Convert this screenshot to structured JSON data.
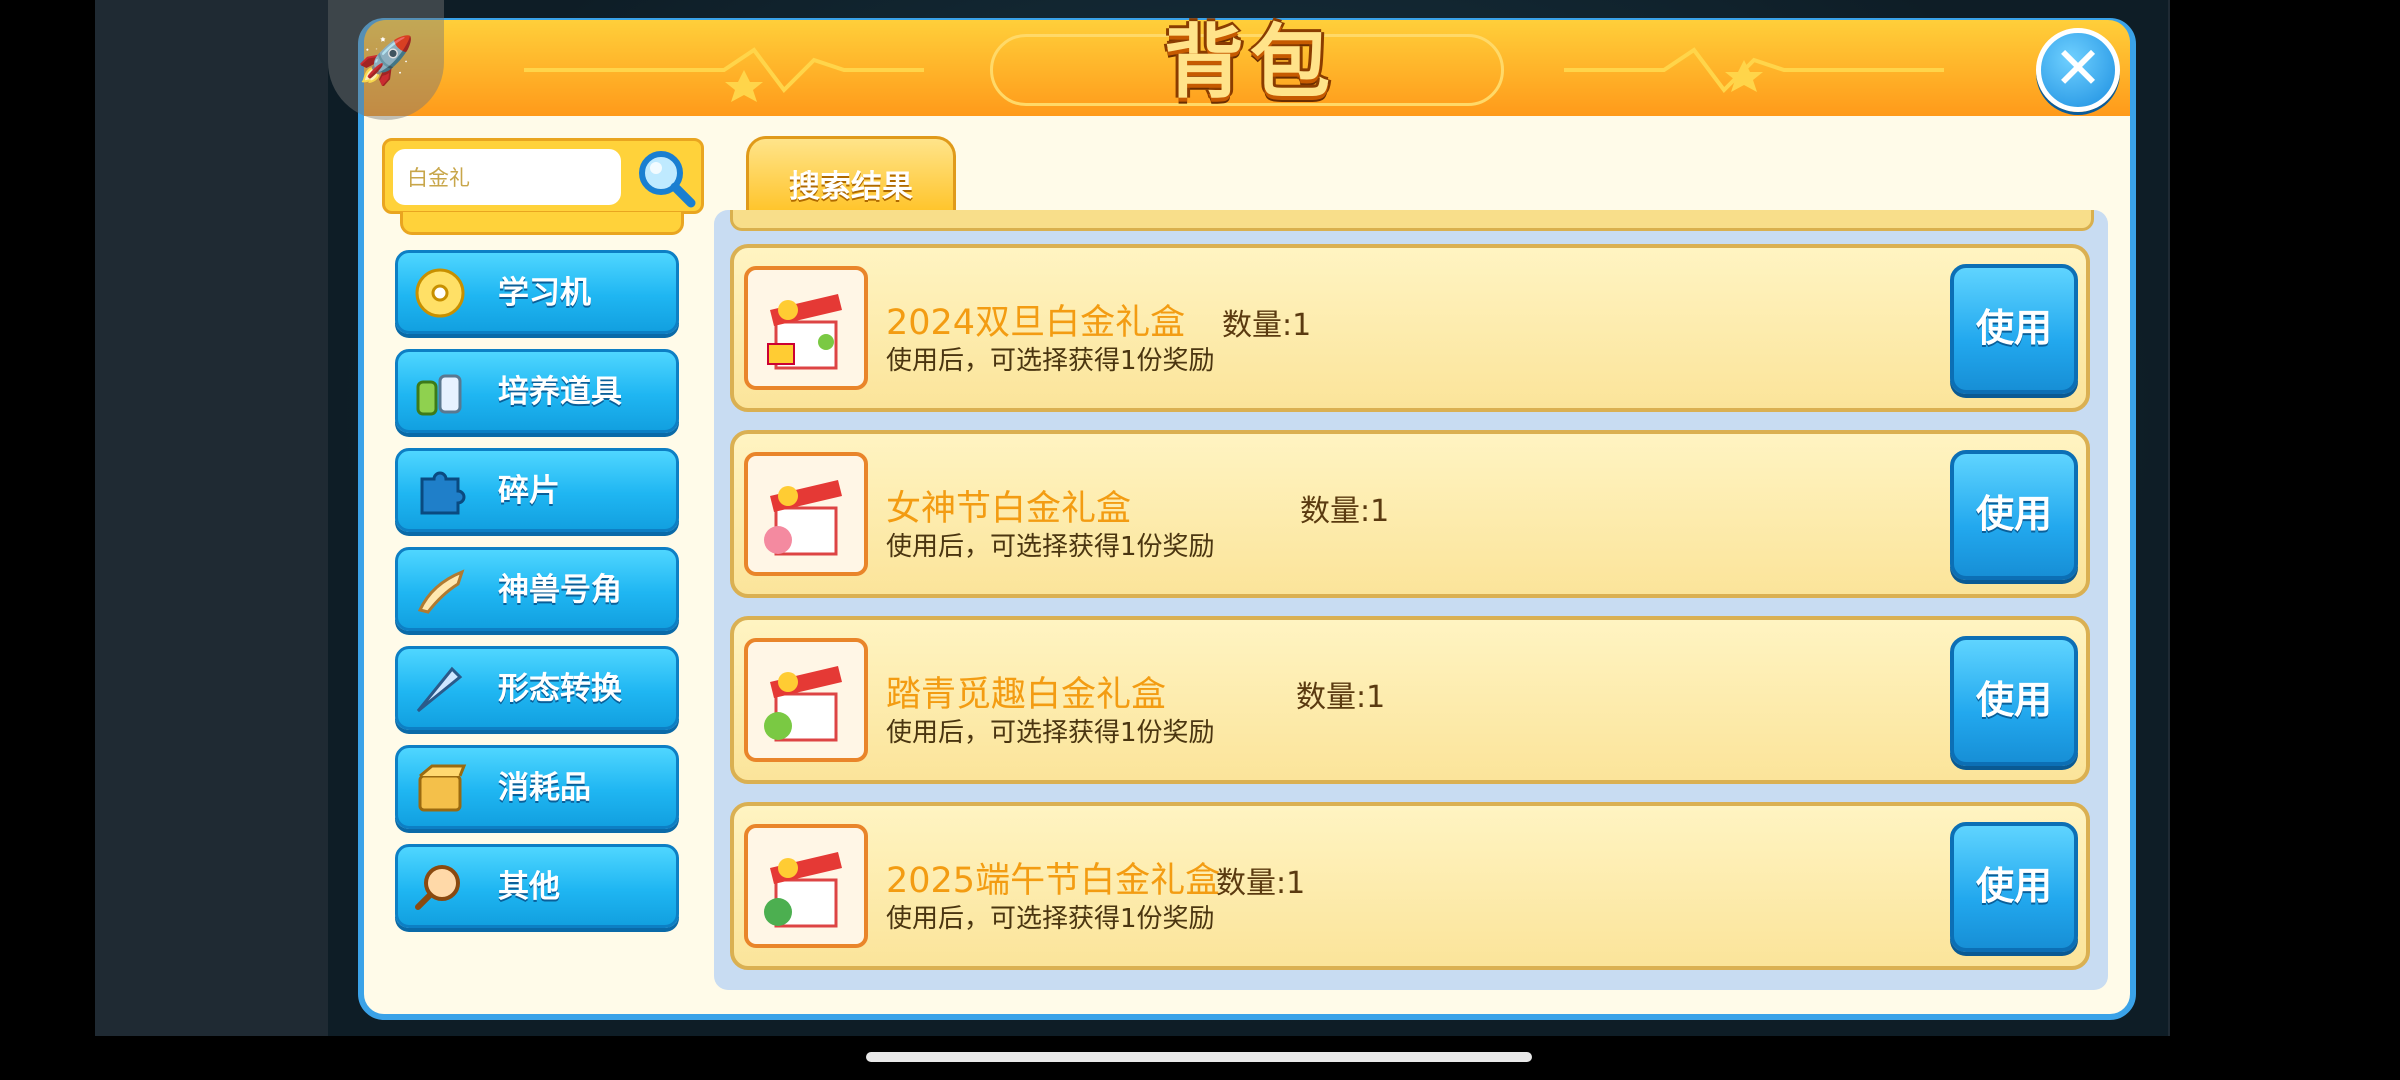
{
  "window": {
    "title": "背包"
  },
  "search": {
    "value": "白金礼"
  },
  "tabs": [
    {
      "label": "搜索结果"
    }
  ],
  "sidebar": {
    "items": [
      {
        "label": "学习机",
        "icon": "disc-icon"
      },
      {
        "label": "培养道具",
        "icon": "bottles-icon"
      },
      {
        "label": "碎片",
        "icon": "puzzle-piece-icon"
      },
      {
        "label": "神兽号角",
        "icon": "horn-icon"
      },
      {
        "label": "形态转换",
        "icon": "arrow-icon"
      },
      {
        "label": "消耗品",
        "icon": "box-icon"
      },
      {
        "label": "其他",
        "icon": "magnifier-icon"
      }
    ]
  },
  "items": [
    {
      "name": "2024双旦白金礼盒",
      "qty": "数量:1",
      "desc": "使用后，可选择获得1份奖励",
      "button": "使用"
    },
    {
      "name": "女神节白金礼盒",
      "qty": "数量:1",
      "desc": "使用后，可选择获得1份奖励",
      "button": "使用"
    },
    {
      "name": "踏青觅趣白金礼盒",
      "qty": "数量:1",
      "desc": "使用后，可选择获得1份奖励",
      "button": "使用"
    },
    {
      "name": "2025端午节白金礼盒",
      "qty": "数量:1",
      "desc": "使用后，可选择获得1份奖励",
      "button": "使用"
    }
  ],
  "colors": {
    "accent_orange": "#ff9a1a",
    "accent_blue": "#1fb6f2",
    "item_name": "#f39c12"
  }
}
